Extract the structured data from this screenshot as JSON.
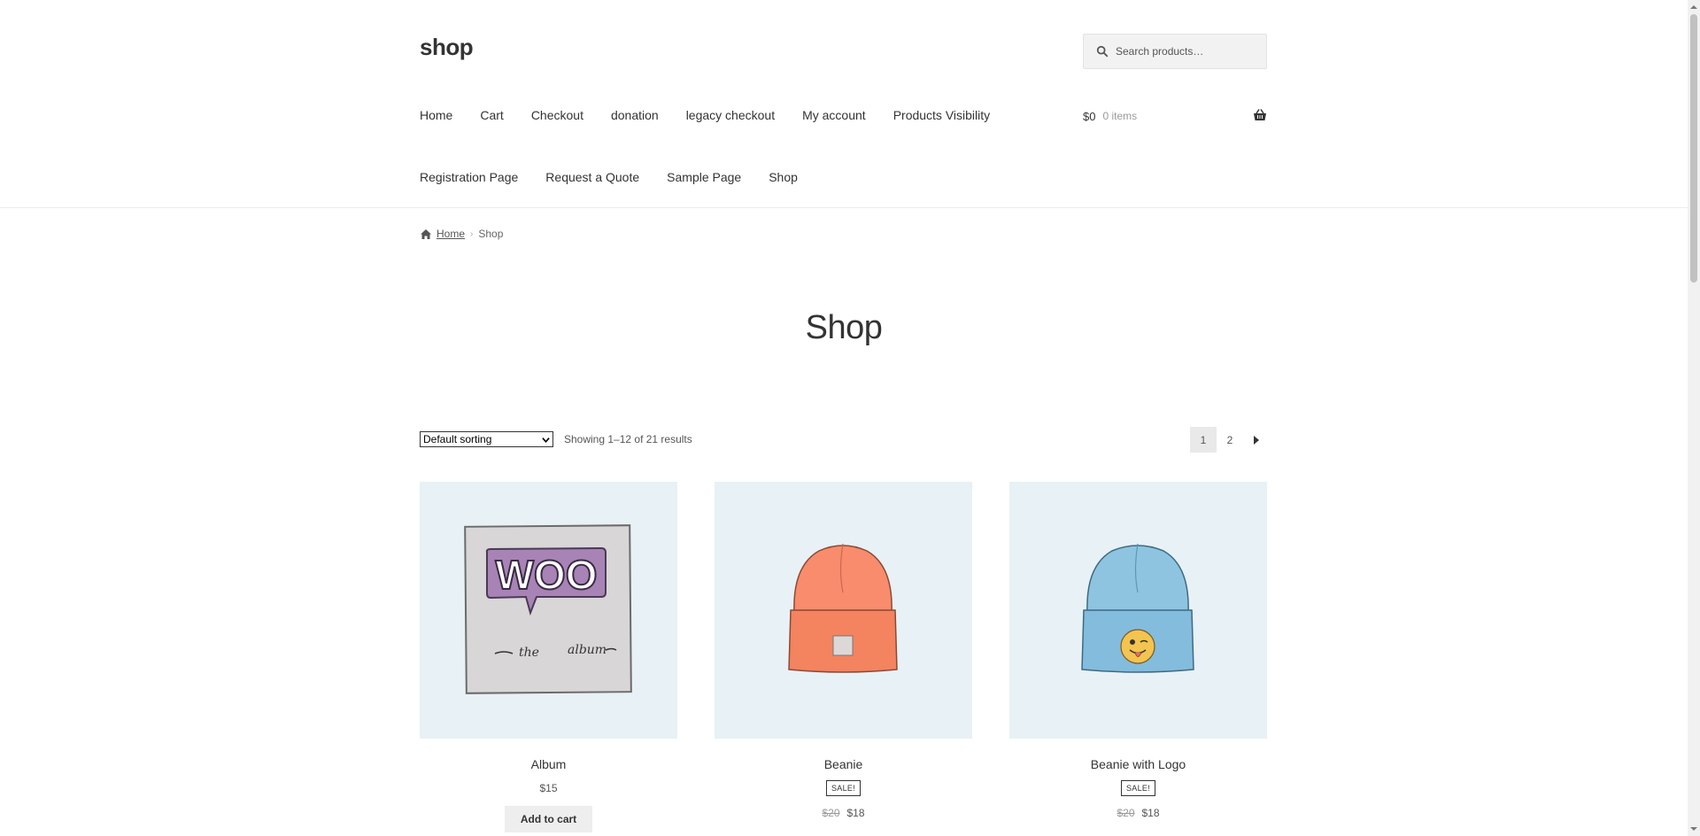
{
  "site": {
    "title": "shop"
  },
  "search": {
    "placeholder": "Search products…"
  },
  "nav": {
    "row1": [
      "Home",
      "Cart",
      "Checkout",
      "donation",
      "legacy checkout",
      "My account",
      "Products Visibility"
    ],
    "row2": [
      "Registration Page",
      "Request a Quote",
      "Sample Page",
      "Shop"
    ]
  },
  "cart": {
    "amount": "$0",
    "items": "0 items"
  },
  "breadcrumb": {
    "home": "Home",
    "current": "Shop"
  },
  "page": {
    "title": "Shop"
  },
  "toolbar": {
    "sort_selected": "Default sorting",
    "result_count": "Showing 1–12 of 21 results",
    "pages": [
      "1",
      "2"
    ],
    "current_page": "1"
  },
  "products": [
    {
      "name": "Album",
      "price": "$15",
      "button": "Add to cart"
    },
    {
      "name": "Beanie",
      "badge": "SALE!",
      "old_price": "$20",
      "price": "$18"
    },
    {
      "name": "Beanie with Logo",
      "badge": "SALE!",
      "old_price": "$20",
      "price": "$18"
    }
  ],
  "colors": {
    "thumb_bg": "#e8f1f5",
    "beanie_orange": "#f88c6c",
    "beanie_blue": "#8fc4e0",
    "woo_purple": "#a883b6"
  },
  "icons": [
    "search-icon",
    "basket-icon",
    "home-icon",
    "chevron-right-icon"
  ]
}
